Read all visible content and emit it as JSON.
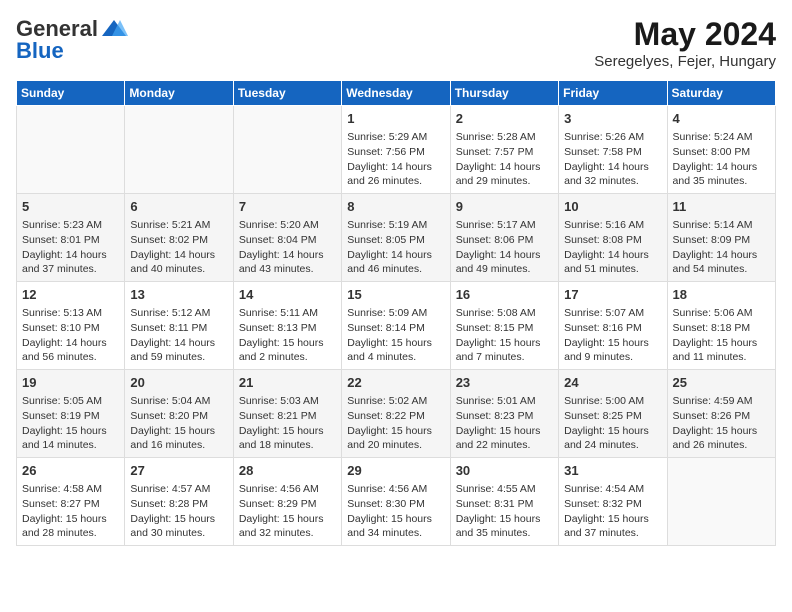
{
  "header": {
    "logo_general": "General",
    "logo_blue": "Blue",
    "title": "May 2024",
    "location": "Seregelyes, Fejer, Hungary"
  },
  "weekdays": [
    "Sunday",
    "Monday",
    "Tuesday",
    "Wednesday",
    "Thursday",
    "Friday",
    "Saturday"
  ],
  "weeks": [
    [
      {
        "day": "",
        "content": ""
      },
      {
        "day": "",
        "content": ""
      },
      {
        "day": "",
        "content": ""
      },
      {
        "day": "1",
        "content": "Sunrise: 5:29 AM\nSunset: 7:56 PM\nDaylight: 14 hours\nand 26 minutes."
      },
      {
        "day": "2",
        "content": "Sunrise: 5:28 AM\nSunset: 7:57 PM\nDaylight: 14 hours\nand 29 minutes."
      },
      {
        "day": "3",
        "content": "Sunrise: 5:26 AM\nSunset: 7:58 PM\nDaylight: 14 hours\nand 32 minutes."
      },
      {
        "day": "4",
        "content": "Sunrise: 5:24 AM\nSunset: 8:00 PM\nDaylight: 14 hours\nand 35 minutes."
      }
    ],
    [
      {
        "day": "5",
        "content": "Sunrise: 5:23 AM\nSunset: 8:01 PM\nDaylight: 14 hours\nand 37 minutes."
      },
      {
        "day": "6",
        "content": "Sunrise: 5:21 AM\nSunset: 8:02 PM\nDaylight: 14 hours\nand 40 minutes."
      },
      {
        "day": "7",
        "content": "Sunrise: 5:20 AM\nSunset: 8:04 PM\nDaylight: 14 hours\nand 43 minutes."
      },
      {
        "day": "8",
        "content": "Sunrise: 5:19 AM\nSunset: 8:05 PM\nDaylight: 14 hours\nand 46 minutes."
      },
      {
        "day": "9",
        "content": "Sunrise: 5:17 AM\nSunset: 8:06 PM\nDaylight: 14 hours\nand 49 minutes."
      },
      {
        "day": "10",
        "content": "Sunrise: 5:16 AM\nSunset: 8:08 PM\nDaylight: 14 hours\nand 51 minutes."
      },
      {
        "day": "11",
        "content": "Sunrise: 5:14 AM\nSunset: 8:09 PM\nDaylight: 14 hours\nand 54 minutes."
      }
    ],
    [
      {
        "day": "12",
        "content": "Sunrise: 5:13 AM\nSunset: 8:10 PM\nDaylight: 14 hours\nand 56 minutes."
      },
      {
        "day": "13",
        "content": "Sunrise: 5:12 AM\nSunset: 8:11 PM\nDaylight: 14 hours\nand 59 minutes."
      },
      {
        "day": "14",
        "content": "Sunrise: 5:11 AM\nSunset: 8:13 PM\nDaylight: 15 hours\nand 2 minutes."
      },
      {
        "day": "15",
        "content": "Sunrise: 5:09 AM\nSunset: 8:14 PM\nDaylight: 15 hours\nand 4 minutes."
      },
      {
        "day": "16",
        "content": "Sunrise: 5:08 AM\nSunset: 8:15 PM\nDaylight: 15 hours\nand 7 minutes."
      },
      {
        "day": "17",
        "content": "Sunrise: 5:07 AM\nSunset: 8:16 PM\nDaylight: 15 hours\nand 9 minutes."
      },
      {
        "day": "18",
        "content": "Sunrise: 5:06 AM\nSunset: 8:18 PM\nDaylight: 15 hours\nand 11 minutes."
      }
    ],
    [
      {
        "day": "19",
        "content": "Sunrise: 5:05 AM\nSunset: 8:19 PM\nDaylight: 15 hours\nand 14 minutes."
      },
      {
        "day": "20",
        "content": "Sunrise: 5:04 AM\nSunset: 8:20 PM\nDaylight: 15 hours\nand 16 minutes."
      },
      {
        "day": "21",
        "content": "Sunrise: 5:03 AM\nSunset: 8:21 PM\nDaylight: 15 hours\nand 18 minutes."
      },
      {
        "day": "22",
        "content": "Sunrise: 5:02 AM\nSunset: 8:22 PM\nDaylight: 15 hours\nand 20 minutes."
      },
      {
        "day": "23",
        "content": "Sunrise: 5:01 AM\nSunset: 8:23 PM\nDaylight: 15 hours\nand 22 minutes."
      },
      {
        "day": "24",
        "content": "Sunrise: 5:00 AM\nSunset: 8:25 PM\nDaylight: 15 hours\nand 24 minutes."
      },
      {
        "day": "25",
        "content": "Sunrise: 4:59 AM\nSunset: 8:26 PM\nDaylight: 15 hours\nand 26 minutes."
      }
    ],
    [
      {
        "day": "26",
        "content": "Sunrise: 4:58 AM\nSunset: 8:27 PM\nDaylight: 15 hours\nand 28 minutes."
      },
      {
        "day": "27",
        "content": "Sunrise: 4:57 AM\nSunset: 8:28 PM\nDaylight: 15 hours\nand 30 minutes."
      },
      {
        "day": "28",
        "content": "Sunrise: 4:56 AM\nSunset: 8:29 PM\nDaylight: 15 hours\nand 32 minutes."
      },
      {
        "day": "29",
        "content": "Sunrise: 4:56 AM\nSunset: 8:30 PM\nDaylight: 15 hours\nand 34 minutes."
      },
      {
        "day": "30",
        "content": "Sunrise: 4:55 AM\nSunset: 8:31 PM\nDaylight: 15 hours\nand 35 minutes."
      },
      {
        "day": "31",
        "content": "Sunrise: 4:54 AM\nSunset: 8:32 PM\nDaylight: 15 hours\nand 37 minutes."
      },
      {
        "day": "",
        "content": ""
      }
    ]
  ]
}
